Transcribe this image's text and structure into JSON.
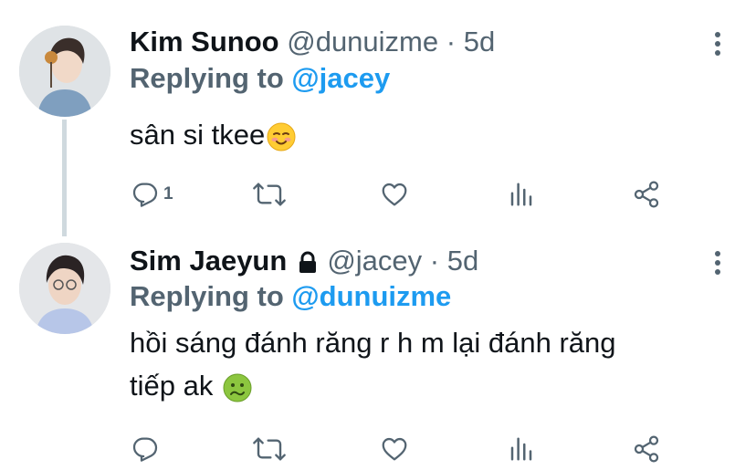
{
  "tweets": [
    {
      "name": "Kim Sunoo",
      "handle": "@dunuizme",
      "separator": "·",
      "time": "5d",
      "replying_label": "Replying to",
      "replying_to": "@jacey",
      "text": "sân si tkee",
      "emoji": "smiling-face-icon",
      "locked": false,
      "reply_count": "1"
    },
    {
      "name": "Sim Jaeyun",
      "handle": "@jacey",
      "separator": "·",
      "time": "5d",
      "replying_label": "Replying to",
      "replying_to": "@dunuizme",
      "text_line1": "hồi sáng đánh răng r h m lại đánh răng",
      "text_line2": "tiếp ak",
      "emoji": "nauseated-face-icon",
      "locked": true,
      "reply_count": ""
    }
  ],
  "colors": {
    "text": "#0f1419",
    "secondary": "#536471",
    "accent": "#1d9bf0",
    "thread_line": "#cfd9de"
  }
}
